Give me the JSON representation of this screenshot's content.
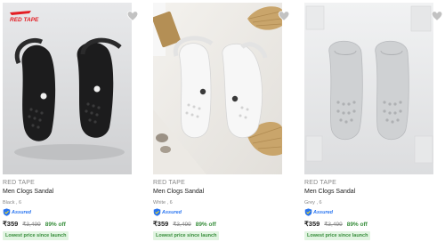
{
  "products": [
    {
      "brand": "RED TAPE",
      "title": "Men Clogs Sandal",
      "variant": "Black , 6",
      "assured_label": "Assured",
      "price": "₹359",
      "mrp": "₹3,499",
      "discount": "89% off",
      "badge": "Lowest price since launch",
      "image_logo": "RED TAPE",
      "wishlist_icon": "heart-icon",
      "colors": {
        "bg": "#d9dadc",
        "shoe": "#1c1c1d"
      }
    },
    {
      "brand": "RED TAPE",
      "title": "Men Clogs Sandal",
      "variant": "White , 6",
      "assured_label": "Assured",
      "price": "₹359",
      "mrp": "₹3,499",
      "discount": "89% off",
      "badge": "Lowest price since launch",
      "wishlist_icon": "heart-icon",
      "colors": {
        "bg": "#e9e7e3",
        "shoe": "#f4f4f4"
      }
    },
    {
      "brand": "RED TAPE",
      "title": "Men Clogs Sandal",
      "variant": "Grey , 6",
      "assured_label": "Assured",
      "price": "₹359",
      "mrp": "₹3,499",
      "discount": "89% off",
      "badge": "Lowest price since launch",
      "wishlist_icon": "heart-icon",
      "colors": {
        "bg": "#e4e5e6",
        "shoe": "#c9cbcd"
      }
    }
  ]
}
